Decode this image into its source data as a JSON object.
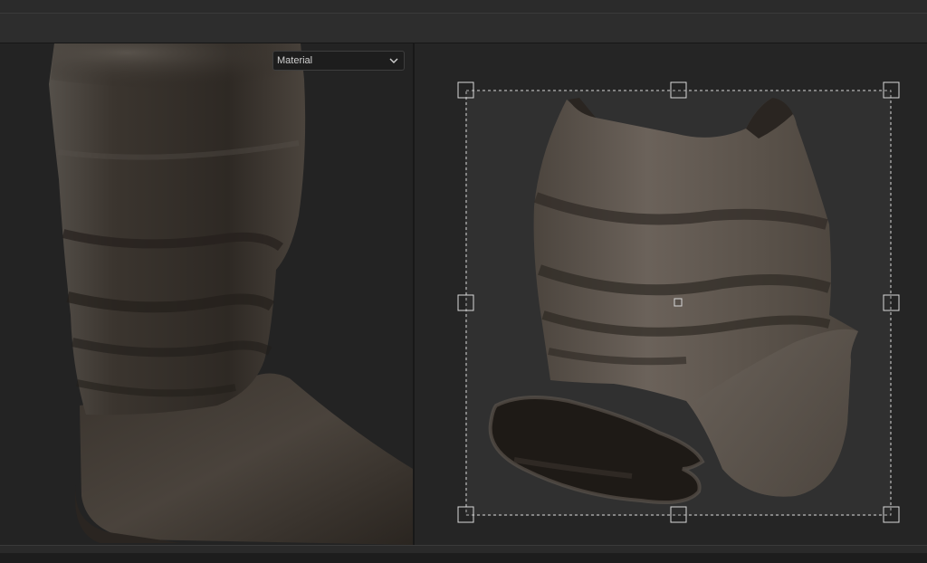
{
  "material_dropdown": {
    "selected": "Material",
    "icon": "chevron-down-icon"
  },
  "colors": {
    "panel_bg": "#232323",
    "uv_bg": "#252525",
    "uv_tile": "#303030",
    "leather_dark": "#2c2622",
    "leather_mid": "#4a413a",
    "leather_light": "#6e655c",
    "axis_x": "#7d6bd8",
    "axis_y": "#73b84a",
    "selection": "#d9d9d9"
  },
  "icons": {
    "axis_gizmo": "axis-gizmo-icon"
  }
}
